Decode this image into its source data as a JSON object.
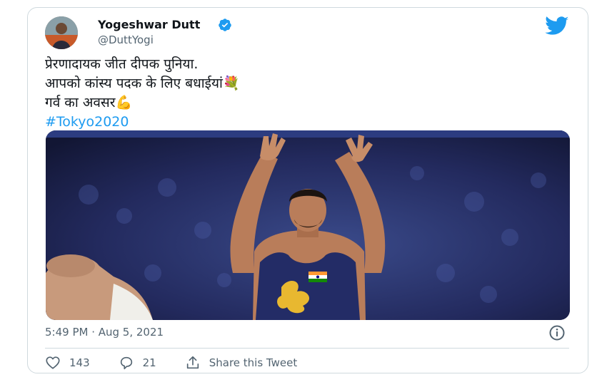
{
  "tweet": {
    "author_name": "Yogeshwar Dutt",
    "author_handle": "@DuttYogi",
    "lines": [
      "प्रेरणादायक जीत दीपक पुनिया.",
      "आपको कांस्य पदक के लिए बधाईयां💐",
      "गर्व का अवसर💪"
    ],
    "hashtag": "#Tokyo2020",
    "timestamp": "5:49 PM · Aug 5, 2021",
    "likes": "143",
    "replies": "21",
    "share_label": "Share this Tweet"
  },
  "icons": {
    "verified": "verified-badge-icon",
    "brand": "twitter-bird-icon",
    "info": "info-icon",
    "like": "heart-icon",
    "reply": "reply-bubble-icon",
    "share": "share-icon"
  },
  "colors": {
    "accent": "#1d9bf0",
    "text": "#0f1419",
    "secondary": "#536471",
    "border": "#cfd9de"
  }
}
